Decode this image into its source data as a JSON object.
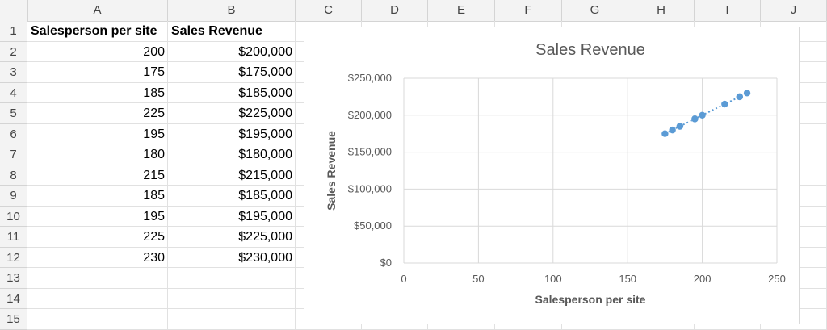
{
  "columns": [
    "A",
    "B",
    "C",
    "D",
    "E",
    "F",
    "G",
    "H",
    "I",
    "J"
  ],
  "rows": [
    "1",
    "2",
    "3",
    "4",
    "5",
    "6",
    "7",
    "8",
    "9",
    "10",
    "11",
    "12",
    "13",
    "14",
    "15"
  ],
  "table": {
    "header_a": "Salesperson per site",
    "header_b": "Sales Revenue",
    "data": [
      {
        "a": "200",
        "b": "$200,000"
      },
      {
        "a": "175",
        "b": "$175,000"
      },
      {
        "a": "185",
        "b": "$185,000"
      },
      {
        "a": "225",
        "b": "$225,000"
      },
      {
        "a": "195",
        "b": "$195,000"
      },
      {
        "a": "180",
        "b": "$180,000"
      },
      {
        "a": "215",
        "b": "$215,000"
      },
      {
        "a": "185",
        "b": "$185,000"
      },
      {
        "a": "195",
        "b": "$195,000"
      },
      {
        "a": "225",
        "b": "$225,000"
      },
      {
        "a": "230",
        "b": "$230,000"
      }
    ]
  },
  "chart_data": {
    "type": "scatter",
    "title": "Sales Revenue",
    "xlabel": "Salesperson per site",
    "ylabel": "Sales Revenue",
    "xlim": [
      0,
      250
    ],
    "ylim": [
      0,
      250000
    ],
    "x_ticks": [
      "0",
      "50",
      "100",
      "150",
      "200",
      "250"
    ],
    "y_ticks": [
      "$0",
      "$50,000",
      "$100,000",
      "$150,000",
      "$200,000",
      "$250,000"
    ],
    "grid": true,
    "trendline": "linear, dotted",
    "series_color": "#5b9bd5",
    "points": [
      {
        "x": 200,
        "y": 200000
      },
      {
        "x": 175,
        "y": 175000
      },
      {
        "x": 185,
        "y": 185000
      },
      {
        "x": 225,
        "y": 225000
      },
      {
        "x": 195,
        "y": 195000
      },
      {
        "x": 180,
        "y": 180000
      },
      {
        "x": 215,
        "y": 215000
      },
      {
        "x": 185,
        "y": 185000
      },
      {
        "x": 195,
        "y": 195000
      },
      {
        "x": 225,
        "y": 225000
      },
      {
        "x": 230,
        "y": 230000
      }
    ]
  }
}
